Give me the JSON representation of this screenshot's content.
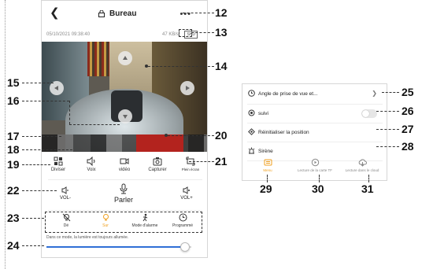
{
  "screen1": {
    "title": "Bureau",
    "datetime": "05/10/2021 09:38:40",
    "data_rate": "47 KB/s",
    "quality_badge": "SHD",
    "toolbar": [
      {
        "label": "Diviser",
        "icon": "split-screen-icon"
      },
      {
        "label": "Voix",
        "icon": "speaker-icon"
      },
      {
        "label": "vidéo",
        "icon": "record-video-icon"
      },
      {
        "label": "Capturer",
        "icon": "camera-snapshot-icon"
      },
      {
        "label": "Plein écran",
        "icon": "fullscreen-icon"
      }
    ],
    "audio": {
      "vol_minus": "VOL-",
      "talk": "Parler",
      "vol_plus": "VOL+"
    },
    "modes": [
      {
        "label": "Dé",
        "icon": "light-off-icon",
        "active": false
      },
      {
        "label": "Sur",
        "icon": "light-on-icon",
        "active": true
      },
      {
        "label": "Mode d'alarme",
        "icon": "alarm-mode-icon",
        "active": false
      },
      {
        "label": "Programmé",
        "icon": "clock-icon",
        "active": false
      }
    ],
    "mode_note": "Dans ce mode, la lumière est toujours allumée.",
    "brightness_level": 0.95
  },
  "screen2": {
    "menu": [
      {
        "label": "Angle de prise de vue et...",
        "icon": "clock-icon",
        "control": "chevron"
      },
      {
        "label": "suivi",
        "icon": "target-icon",
        "control": "toggle",
        "enabled": false
      },
      {
        "label": "Réinitialiser la position",
        "icon": "reset-icon",
        "control": "none"
      },
      {
        "label": "Sirène",
        "icon": "siren-icon",
        "control": "none"
      }
    ],
    "actions": [
      {
        "label": "Menu",
        "icon": "menu-icon",
        "active": true
      },
      {
        "label": "Lecture de la carte TF",
        "icon": "playback-sd-icon",
        "active": false
      },
      {
        "label": "Lecture dans le cloud",
        "icon": "cloud-playback-icon",
        "active": false
      }
    ]
  },
  "callouts": {
    "n12": "12",
    "n13": "13",
    "n14": "14",
    "n15": "15",
    "n16": "16",
    "n17": "17",
    "n18": "18",
    "n19": "19",
    "n20": "20",
    "n21": "21",
    "n22": "22",
    "n23": "23",
    "n24": "24",
    "n25": "25",
    "n26": "26",
    "n27": "27",
    "n28": "28",
    "n29": "29",
    "n30": "30",
    "n31": "31"
  },
  "colors": {
    "accent": "#f0a020",
    "slider": "#2f6fd6",
    "video_red": "#b3231e"
  }
}
